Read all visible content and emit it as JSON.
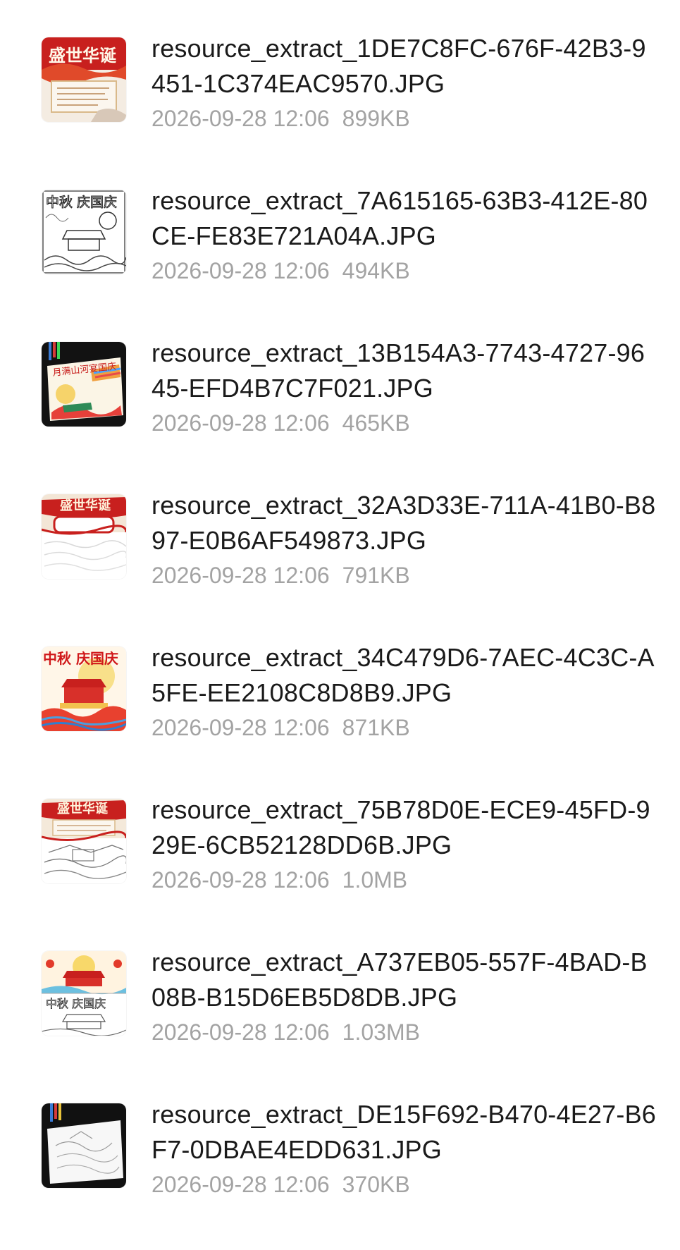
{
  "files": [
    {
      "name": "resource_extract_1DE7C8FC-676F-42B3-9451-1C374EAC9570.JPG",
      "date": "2026-09-28 12:06",
      "size": "899KB",
      "thumb": "red-poster-thumbnail",
      "thumb_text": "盛世华诞"
    },
    {
      "name": "resource_extract_7A615165-63B3-412E-80CE-FE83E721A04A.JPG",
      "date": "2026-09-28 12:06",
      "size": "494KB",
      "thumb": "line-drawing-thumbnail",
      "thumb_text": "中秋 庆国庆"
    },
    {
      "name": "resource_extract_13B154A3-7743-4727-9645-EFD4B7C7F021.JPG",
      "date": "2026-09-28 12:06",
      "size": "465KB",
      "thumb": "colored-card-on-dark-thumbnail",
      "thumb_text": "月满山河宴国庆"
    },
    {
      "name": "resource_extract_32A3D33E-711A-41B0-B897-E0B6AF549873.JPG",
      "date": "2026-09-28 12:06",
      "size": "791KB",
      "thumb": "red-banner-half-thumbnail",
      "thumb_text": "盛世华诞"
    },
    {
      "name": "resource_extract_34C479D6-7AEC-4C3C-A5FE-EE2108C8D8B9.JPG",
      "date": "2026-09-28 12:06",
      "size": "871KB",
      "thumb": "red-gate-moon-thumbnail",
      "thumb_text": "中秋 庆国庆"
    },
    {
      "name": "resource_extract_75B78D0E-ECE9-45FD-929E-6CB52128DD6B.JPG",
      "date": "2026-09-28 12:06",
      "size": "1.0MB",
      "thumb": "red-banner-sketch-thumbnail",
      "thumb_text": "盛世华诞"
    },
    {
      "name": "resource_extract_A737EB05-557F-4BAD-B08B-B15D6EB5D8DB.JPG",
      "date": "2026-09-28 12:06",
      "size": "1.03MB",
      "thumb": "color-and-sketch-thumbnail",
      "thumb_text": "中秋 庆国庆"
    },
    {
      "name": "resource_extract_DE15F692-B470-4E27-B6F7-0DBAE4EDD631.JPG",
      "date": "2026-09-28 12:06",
      "size": "370KB",
      "thumb": "sketch-card-on-dark-thumbnail",
      "thumb_text": ""
    }
  ],
  "colors": {
    "name_text": "#1a1a1a",
    "meta_text": "#a3a3a3",
    "poster_red": "#c8201e",
    "background": "#ffffff"
  }
}
